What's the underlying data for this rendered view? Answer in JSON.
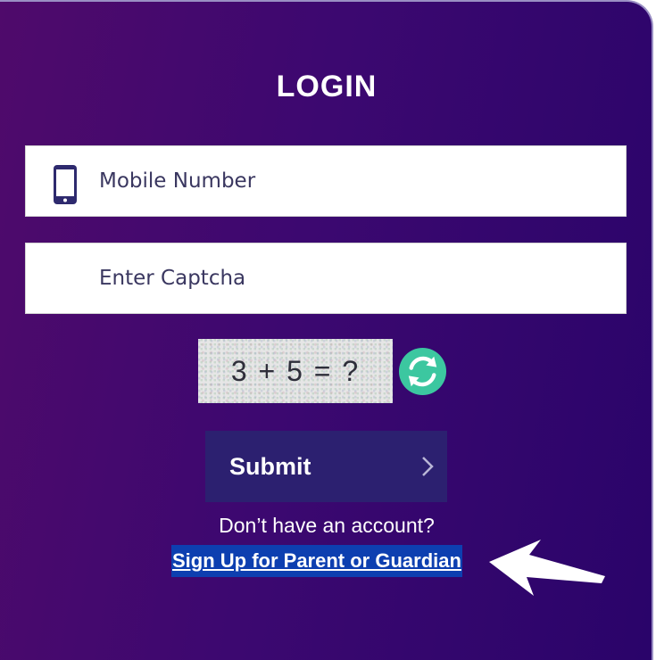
{
  "login": {
    "title": "LOGIN",
    "mobile_placeholder": "Mobile Number",
    "captcha_placeholder": "Enter Captcha",
    "captcha_text": "3 + 5 = ?",
    "submit_label": "Submit",
    "no_account_text": "Don’t have an account?",
    "signup_link": "Sign Up for Parent or Guardian"
  },
  "icons": {
    "mobile": "mobile-phone-icon",
    "refresh": "refresh-icon",
    "submit_chevron": "chevron-right-icon",
    "pointer": "arrow-left-icon"
  },
  "colors": {
    "background_start": "#4f0a6b",
    "background_end": "#2a046a",
    "submit_bg": "#2c2070",
    "refresh_green": "#3cc7a0",
    "link_highlight": "#0d3fb0"
  }
}
